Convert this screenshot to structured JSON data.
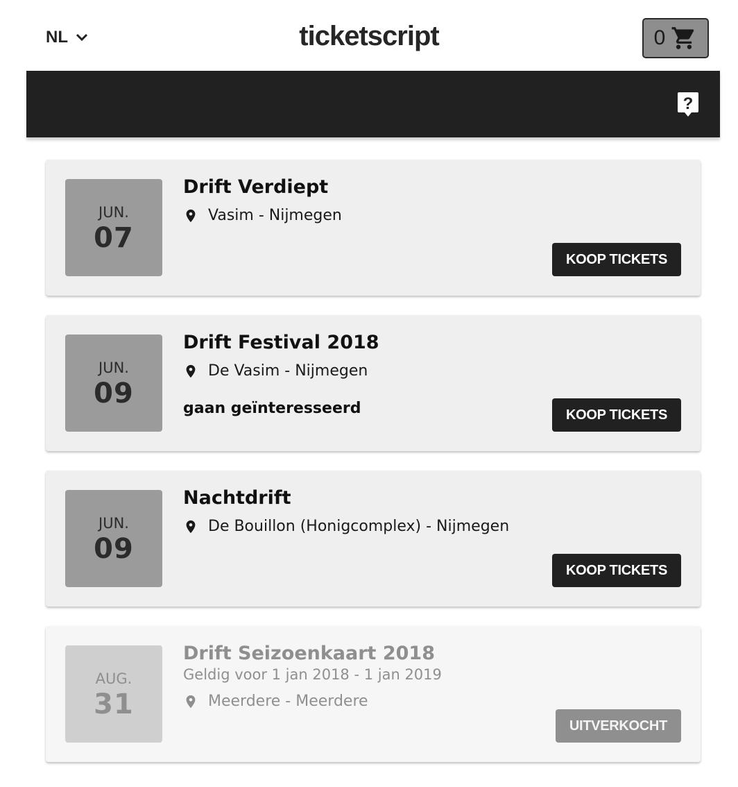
{
  "header": {
    "language": "NL",
    "brand": "ticketscript",
    "cart_count": "0"
  },
  "events": [
    {
      "month": "JUN.",
      "day": "07",
      "title": "Drift Verdiept",
      "location": "Vasim - Nijmegen",
      "button": "KOOP TICKETS"
    },
    {
      "month": "JUN.",
      "day": "09",
      "title": "Drift Festival 2018",
      "location": "De Vasim - Nijmegen",
      "interest": "gaan geïnteresseerd",
      "button": "KOOP TICKETS"
    },
    {
      "month": "JUN.",
      "day": "09",
      "title": "Nachtdrift",
      "location": "De Bouillon (Honigcomplex) - Nijmegen",
      "button": "KOOP TICKETS"
    },
    {
      "month": "AUG.",
      "day": "31",
      "title": "Drift Seizoenkaart 2018",
      "validity": "Geldig voor 1 jan 2018 - 1 jan 2019",
      "location": "Meerdere - Meerdere",
      "button": "UITVERKOCHT"
    }
  ]
}
